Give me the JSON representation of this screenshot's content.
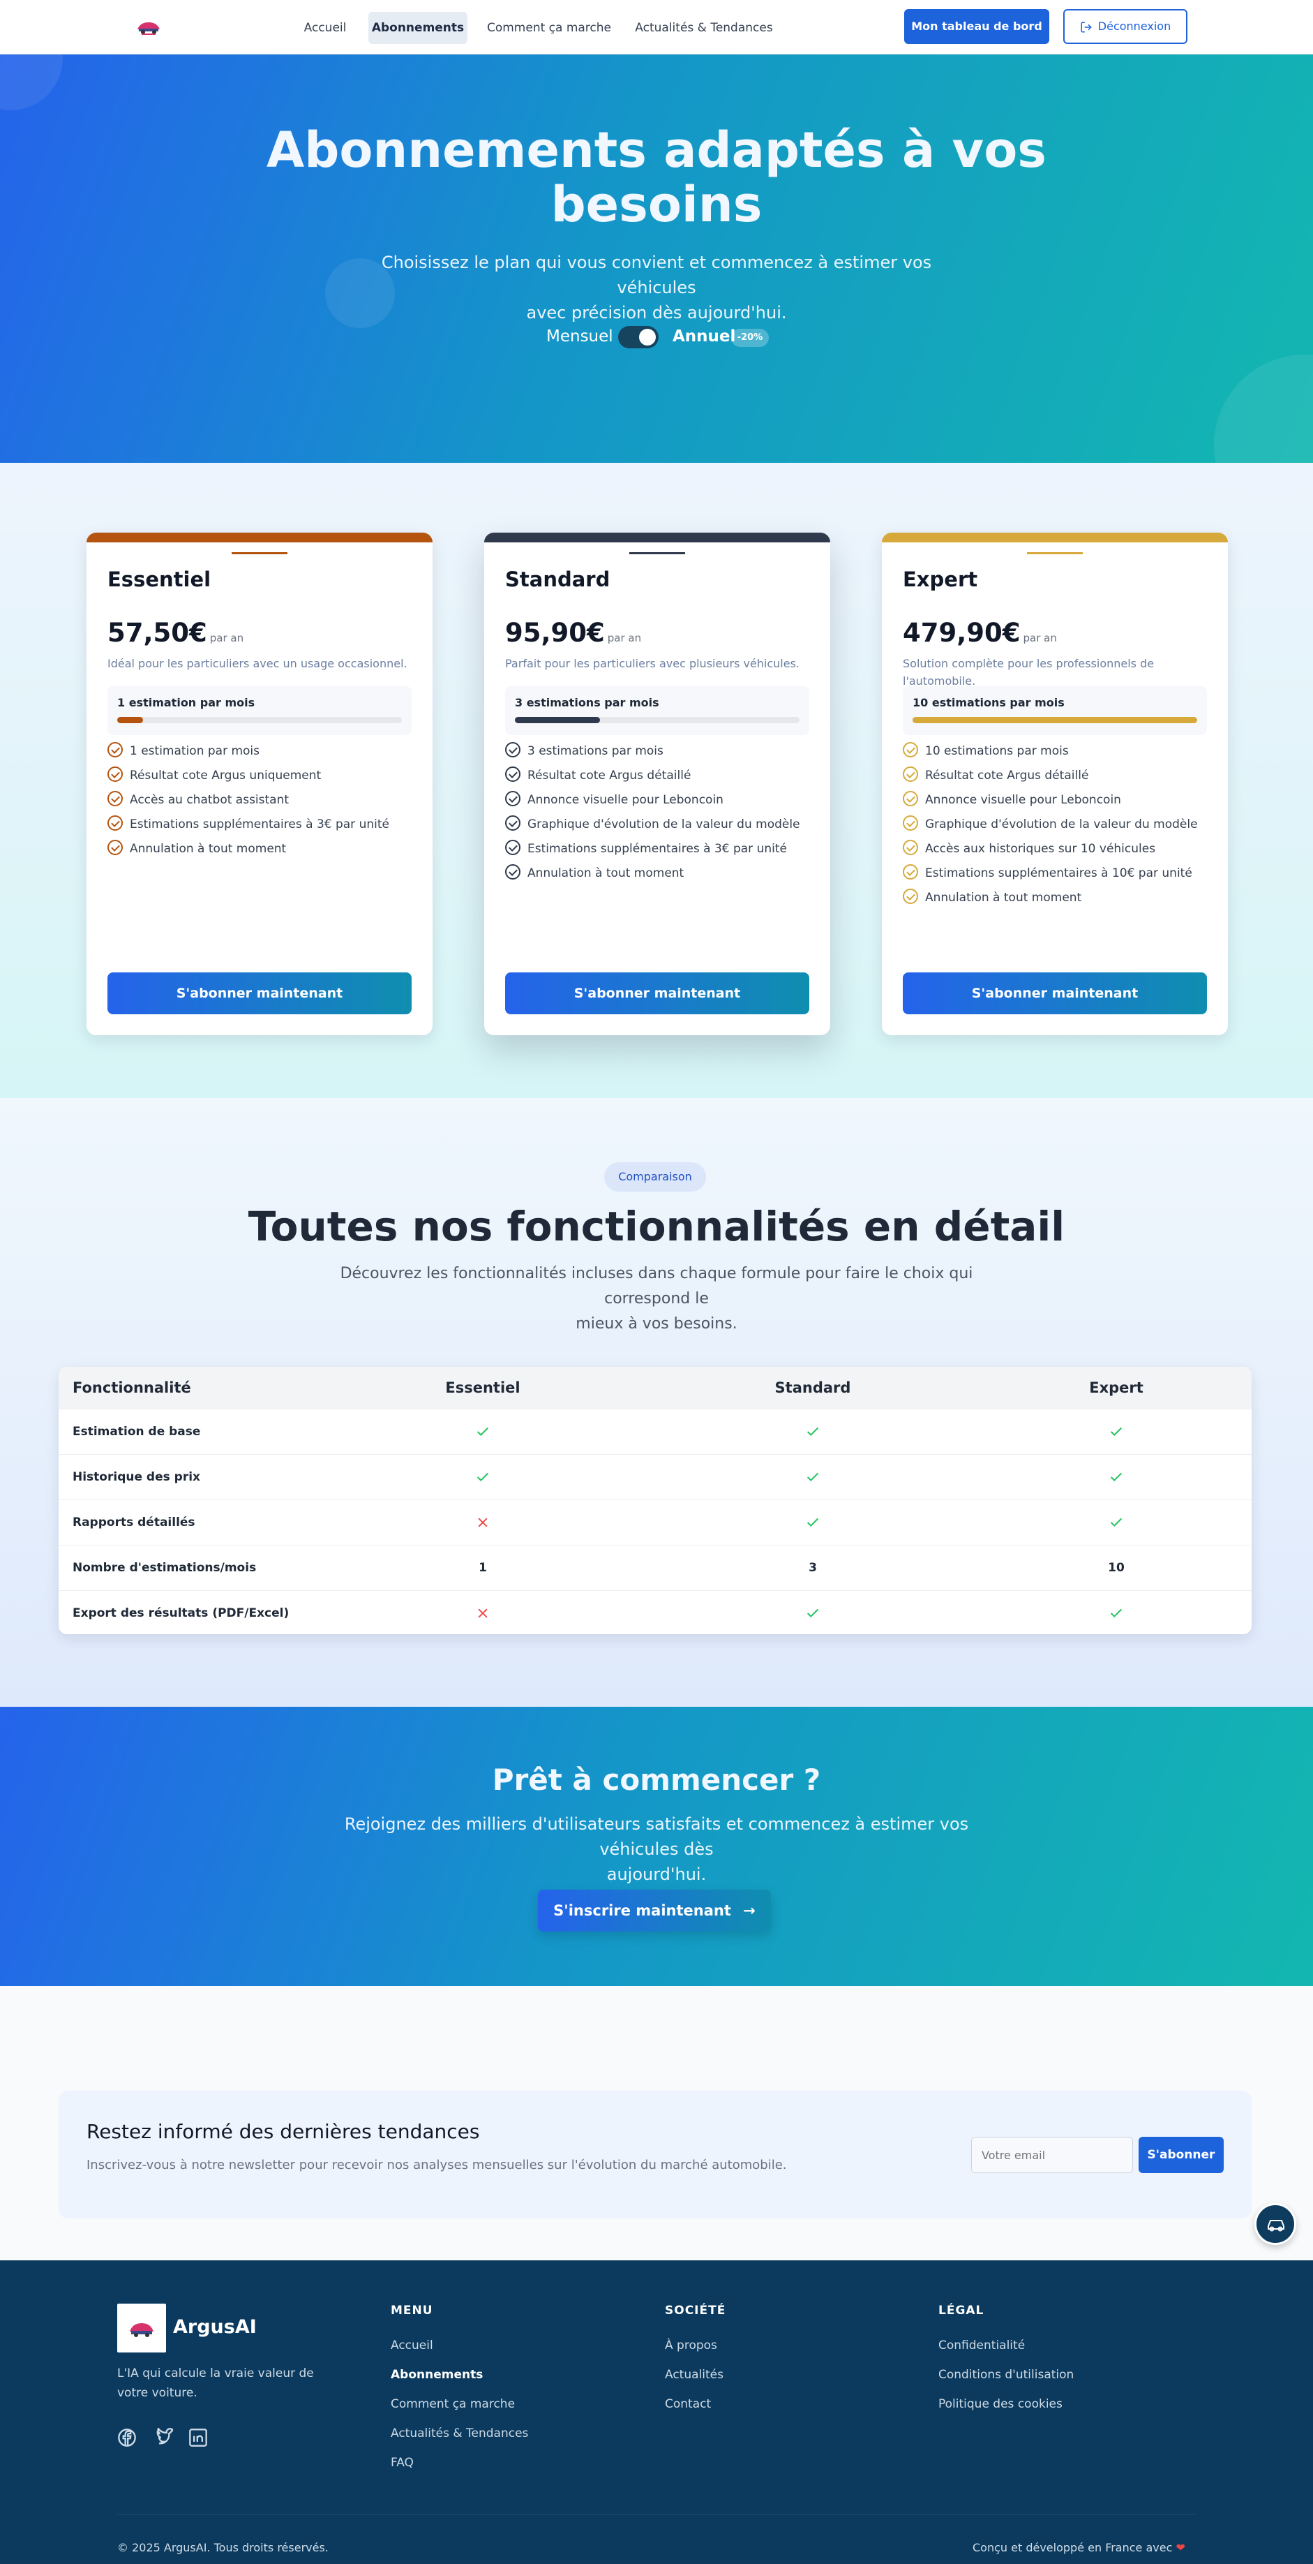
{
  "nav": {
    "links": [
      "Accueil",
      "Abonnements",
      "Comment ça marche",
      "Actualités & Tendances"
    ],
    "active": "Abonnements",
    "dashboard_label": "Mon tableau de bord",
    "logout_label": "Déconnexion"
  },
  "hero": {
    "title_line1": "Abonnements adaptés à vos",
    "title_line2": "besoins",
    "subtitle_line1": "Choisissez le plan qui vous convient et commencez à estimer vos véhicules",
    "subtitle_line2": "avec précision dès aujourd'hui.",
    "toggle_monthly": "Mensuel",
    "toggle_annual": "Annuel",
    "annual_selected": true,
    "discount_badge": "-20%"
  },
  "plans": [
    {
      "name": "Essentiel",
      "price": "57,50€",
      "period": "par an",
      "description": "Idéal pour les particuliers avec un usage occasionnel.",
      "quota_label": "1 estimation par mois",
      "quota_fraction": 0.09,
      "accent": "#b5540f",
      "features": [
        "1 estimation par mois",
        "Résultat cote Argus uniquement",
        "Accès au chatbot assistant",
        "Estimations supplémentaires à 3€ par unité",
        "Annulation à tout moment"
      ],
      "cta": "S'abonner maintenant"
    },
    {
      "name": "Standard",
      "price": "95,90€",
      "period": "par an",
      "description": "Parfait pour les particuliers avec plusieurs véhicules.",
      "quota_label": "3 estimations par mois",
      "quota_fraction": 0.3,
      "accent": "#2f3a4d",
      "features": [
        "3 estimations par mois",
        "Résultat cote Argus détaillé",
        "Annonce visuelle pour Leboncoin",
        "Graphique d'évolution de la valeur du modèle",
        "Estimations supplémentaires à 3€ par unité",
        "Annulation à tout moment"
      ],
      "cta": "S'abonner maintenant"
    },
    {
      "name": "Expert",
      "price": "479,90€",
      "period": "par an",
      "description": "Solution complète pour les professionnels de l'automobile.",
      "quota_label": "10 estimations par mois",
      "quota_fraction": 1,
      "accent": "#d6a93a",
      "features": [
        "10 estimations par mois",
        "Résultat cote Argus détaillé",
        "Annonce visuelle pour Leboncoin",
        "Graphique d'évolution de la valeur du modèle",
        "Accès aux historiques sur 10 véhicules",
        "Estimations supplémentaires à 10€ par unité",
        "Annulation à tout moment"
      ],
      "cta": "S'abonner maintenant"
    }
  ],
  "comparison": {
    "badge": "Comparaison",
    "title": "Toutes nos fonctionnalités en détail",
    "subtitle_line1": "Découvrez les fonctionnalités incluses dans chaque formule pour faire le choix qui correspond le",
    "subtitle_line2": "mieux à vos besoins.",
    "headers": [
      "Fonctionnalité",
      "Essentiel",
      "Standard",
      "Expert"
    ],
    "rows": [
      {
        "feature": "Estimation de base",
        "values": [
          "check",
          "check",
          "check"
        ]
      },
      {
        "feature": "Historique des prix",
        "values": [
          "check",
          "check",
          "check"
        ]
      },
      {
        "feature": "Rapports détaillés",
        "values": [
          "cross",
          "check",
          "check"
        ]
      },
      {
        "feature": "Nombre d'estimations/mois",
        "values": [
          "1",
          "3",
          "10"
        ]
      },
      {
        "feature": "Export des résultats (PDF/Excel)",
        "values": [
          "cross",
          "check",
          "check"
        ]
      }
    ]
  },
  "cta": {
    "title": "Prêt à commencer ?",
    "text_line1": "Rejoignez des milliers d'utilisateurs satisfaits et commencez à estimer vos véhicules dès",
    "text_line2": "aujourd'hui.",
    "button": "S'inscrire maintenant"
  },
  "newsletter": {
    "title": "Restez informé des dernières tendances",
    "text": "Inscrivez-vous à notre newsletter pour recevoir nos analyses mensuelles sur l'évolution du marché automobile.",
    "placeholder": "Votre email",
    "button": "S'abonner"
  },
  "footer": {
    "brand": "ArgusAI",
    "tagline": "L'IA qui calcule la vraie valeur de votre voiture.",
    "menu_title": "MENU",
    "menu": [
      "Accueil",
      "Abonnements",
      "Comment ça marche",
      "Actualités & Tendances",
      "FAQ"
    ],
    "company_title": "SOCIÉTÉ",
    "company": [
      "À propos",
      "Actualités",
      "Contact"
    ],
    "legal_title": "LÉGAL",
    "legal": [
      "Confidentialité",
      "Conditions d'utilisation",
      "Politique des cookies"
    ],
    "copyright": "© 2025 ArgusAI. Tous droits réservés.",
    "made_in": "Conçu et développé en France avec"
  },
  "colors": {
    "primary": "#1d63db",
    "footer_bg": "#0b3a5e",
    "check": "#22c55e",
    "cross": "#ef4444"
  }
}
